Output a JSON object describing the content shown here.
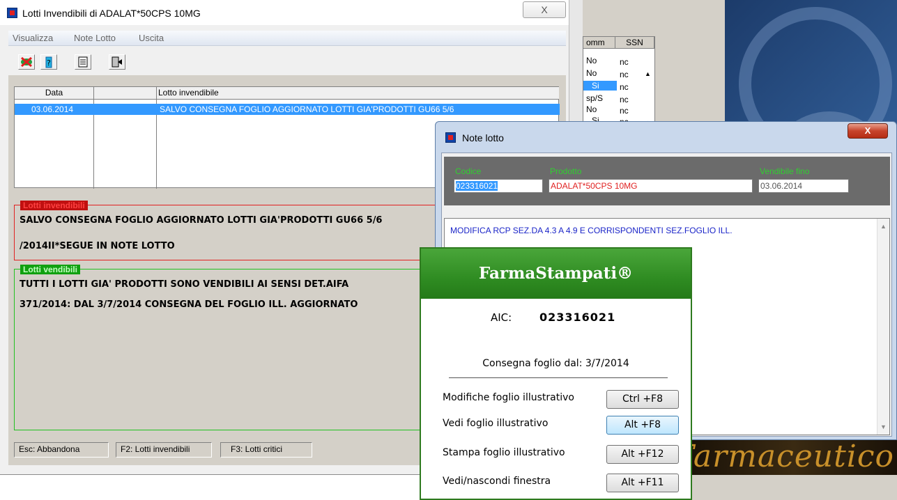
{
  "background": {
    "list_headers": [
      "omm",
      "SSN"
    ],
    "list_rows": [
      [
        "No",
        "nc"
      ],
      [
        "No",
        "nc"
      ],
      [
        "Si",
        "nc"
      ],
      [
        "sp/S",
        "nc"
      ],
      [
        "No",
        "nc"
      ],
      [
        "Si",
        "nc"
      ]
    ],
    "strip_text": ": Farmaceutico"
  },
  "main_window": {
    "title": "Lotti Invendibili di ADALAT*50CPS 10MG",
    "close_glyph": "X",
    "menu": [
      "Visualizza",
      "Note Lotto",
      "Uscita"
    ],
    "grid": {
      "columns": [
        "Data",
        "",
        "Lotto invendibile"
      ],
      "rows": [
        {
          "data": "03.06.2014",
          "col2": "",
          "lotto": "SALVO CONSEGNA FOGLIO AGGIORNATO LOTTI GIA'PRODOTTI GU66 5/6"
        }
      ]
    },
    "invendibili": {
      "label": "Lotti invendibili",
      "line1": "SALVO CONSEGNA FOGLIO AGGIORNATO LOTTI GIA'PRODOTTI GU66 5/6",
      "line2": "/2014II*SEGUE IN NOTE LOTTO"
    },
    "vendibili": {
      "label": "Lotti vendibili",
      "line1": "TUTTI I LOTTI GIA' PRODOTTI SONO VENDIBILI AI SENSI DET.AIFA",
      "line2": "371/2014: DAL 3/7/2014 CONSEGNA DEL FOGLIO ILL. AGGIORNATO"
    },
    "status": [
      "Esc: Abbandona",
      "F2: Lotti invendibili",
      "F3: Lotti critici"
    ]
  },
  "note_lotto": {
    "title": "Note lotto",
    "close_glyph": "X",
    "codice_label": "Codice",
    "codice_value": "023316021",
    "prodotto_label": "Prodotto",
    "prodotto_value": "ADALAT*50CPS 10MG",
    "vendibile_label": "Vendibile fino",
    "vendibile_value": "03.06.2014",
    "memo": "MODIFICA RCP SEZ.DA 4.3 A 4.9 E CORRISPONDENTI SEZ.FOGLIO ILL."
  },
  "farmastampati": {
    "title": "FarmaStampati®",
    "aic_label": "AIC:",
    "aic_value": "023316021",
    "consegna": "Consegna foglio dal: 3/7/2014",
    "actions": [
      {
        "label": "Modifiche foglio illustrativo",
        "shortcut": "Ctrl +F8"
      },
      {
        "label": "Vedi foglio illustrativo",
        "shortcut": "Alt +F8"
      },
      {
        "label": "Stampa foglio illustrativo",
        "shortcut": "Alt +F12"
      },
      {
        "label": "Vedi/nascondi finestra",
        "shortcut": "Alt +F11"
      }
    ]
  },
  "colors": {
    "selection_blue": "#3399ff",
    "invendibili_red": "#e02020",
    "vendibili_green": "#20c020",
    "farma_green": "#2f8c22",
    "memo_blue": "#1a24c8"
  }
}
